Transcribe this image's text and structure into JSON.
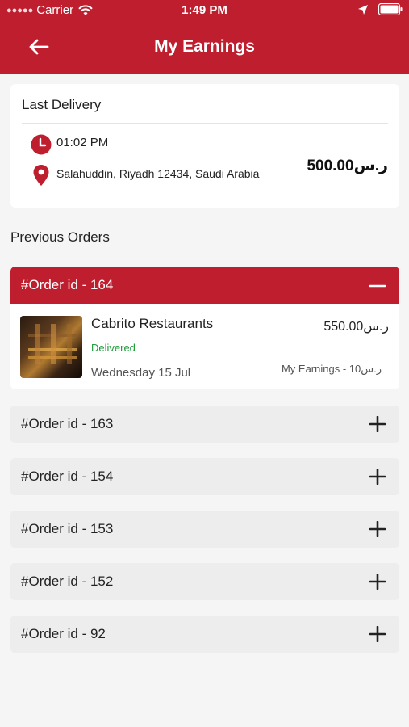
{
  "status_bar": {
    "carrier": "Carrier",
    "time": "1:49 PM"
  },
  "header": {
    "title": "My Earnings",
    "back_icon": "arrow-left-icon"
  },
  "last_delivery": {
    "title": "Last Delivery",
    "time": "01:02 PM",
    "address": "Salahuddin, Riyadh 12434, Saudi Arabia",
    "amount": "500.00ر.س"
  },
  "previous_orders": {
    "title": "Previous Orders",
    "expanded": {
      "label": "#Order id - 164",
      "restaurant": "Cabrito Restaurants",
      "status": "Delivered",
      "date": "Wednesday 15 Jul",
      "amount": "550.00ر.س",
      "earnings": "My Earnings - 10ر.س"
    },
    "collapsed": [
      {
        "label": "#Order id - 163"
      },
      {
        "label": "#Order id - 154"
      },
      {
        "label": "#Order id - 153"
      },
      {
        "label": "#Order id - 152"
      },
      {
        "label": "#Order id - 92"
      }
    ]
  },
  "colors": {
    "brand": "#bf1e2e",
    "status_delivered": "#1e9a3a",
    "row_background": "#ededed"
  }
}
